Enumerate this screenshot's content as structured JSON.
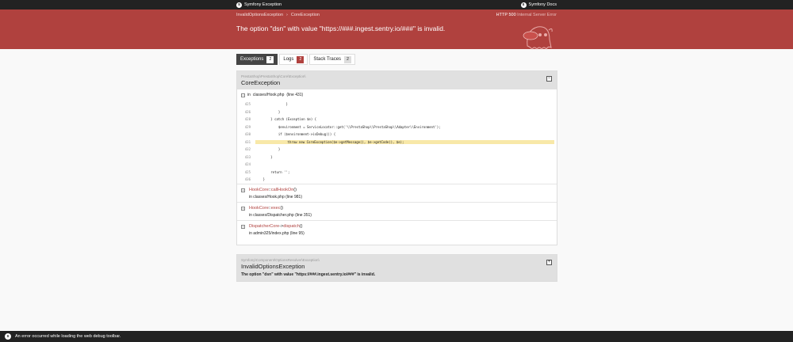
{
  "topbar": {
    "brand": "Symfony Exception",
    "docs": "Symfony Docs"
  },
  "header": {
    "breadcrumb": [
      "InvalidOptionsException",
      "CoreException"
    ],
    "status_code": "HTTP 500",
    "status_text": "Internal Server Error",
    "message": "The option \"dsn\" with value \"https://###.ingest.sentry.io/###\" is invalid."
  },
  "tabs": [
    {
      "label": "Exceptions",
      "count": "2"
    },
    {
      "label": "Logs",
      "count": "2"
    },
    {
      "label": "Stack Traces",
      "count": "2"
    }
  ],
  "exception1": {
    "namespace": "PrestaShop\\PrestaShop\\Core\\Exception\\",
    "name": "CoreException",
    "first_trace": {
      "in": "in",
      "file": "classes/Hook.php",
      "line": "(line 431)"
    },
    "code": [
      {
        "num": "425",
        "src": "                }"
      },
      {
        "num": "426",
        "src": "            }"
      },
      {
        "num": "428",
        "src": "        } catch (Exception $e) {"
      },
      {
        "num": "429",
        "src": "            $environment = ServiceLocator::get('\\\\PrestaShop\\\\PrestaShop\\\\Adapter\\\\Environment');"
      },
      {
        "num": "430",
        "src": "            if ($environment->isDebug()) {"
      },
      {
        "num": "431",
        "src": "                throw new CoreException($e->getMessage(), $e->getCode(), $e);"
      },
      {
        "num": "432",
        "src": "            }"
      },
      {
        "num": "433",
        "src": "        }"
      },
      {
        "num": "424",
        "src": ""
      },
      {
        "num": "425",
        "src": "        return '';"
      },
      {
        "num": "436",
        "src": "    }"
      }
    ],
    "traces": [
      {
        "class": "HookCore",
        "sep": "::",
        "method": "callHookOn",
        "paren": "()",
        "location": "in classes/Hook.php (line 981)"
      },
      {
        "class": "HookCore",
        "sep": "::",
        "method": "exec",
        "paren": "()",
        "location": "in classes/Dispatcher.php (line 351)"
      },
      {
        "class": "DispatcherCore",
        "sep": "->",
        "method": "dispatch",
        "paren": "()",
        "location": "in admin325/index.php (line 95)"
      }
    ]
  },
  "exception2": {
    "namespace": "Symfony\\Component\\OptionsResolver\\Exception\\",
    "name": "InvalidOptionsException",
    "message": "The option \"dsn\" with value \"https://###.ingest.sentry.io/###\" is invalid."
  },
  "footer": {
    "text": "An error occurred while loading the web debug toolbar."
  },
  "colors": {
    "header": "#b0413e",
    "topbar": "#222222",
    "highlight": "#f8e8a8"
  }
}
